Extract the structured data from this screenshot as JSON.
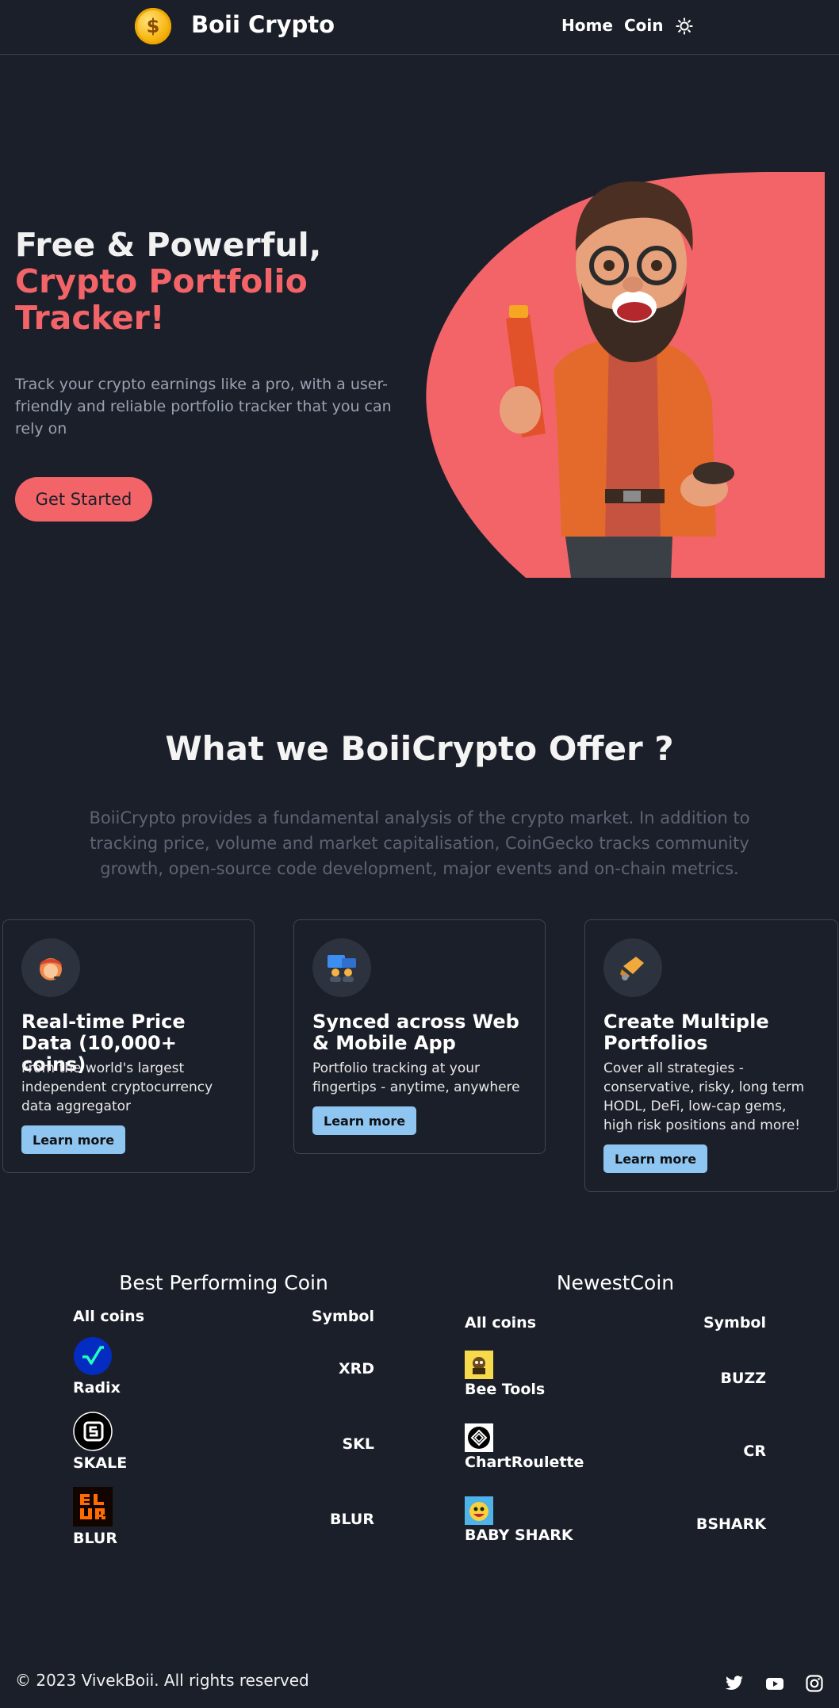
{
  "header": {
    "brand": "Boii Crypto",
    "logo_glyph": "$",
    "nav": [
      "Home",
      "Coin"
    ],
    "theme_icon": "sun-icon"
  },
  "hero": {
    "title_line1": "Free & Powerful,",
    "title_accent": "Crypto Portfolio Tracker!",
    "text": "Track your crypto earnings like a pro, with a user-friendly and reliable portfolio tracker that you can rely on",
    "cta": "Get Started",
    "accent_color": "#f36469"
  },
  "offer": {
    "title": "What we BoiiCrypto Offer ?",
    "text": "BoiiCrypto provides a fundamental analysis of the crypto market. In addition to tracking price, volume and market capitalisation, CoinGecko tracks community growth, open-source code development, major events and on-chain metrics.",
    "cards": [
      {
        "icon": "support-agent-icon",
        "title": "Real-time Price Data (10,000+ coins)",
        "text": "From the world's largest independent cryptocurrency data aggregator",
        "button": "Learn more"
      },
      {
        "icon": "devices-team-icon",
        "title": "Synced across Web & Mobile App",
        "text": "Portfolio tracking at your fingertips - anytime, anywhere",
        "button": "Learn more"
      },
      {
        "icon": "handshake-icon",
        "title": "Create Multiple Portfolios",
        "text": "Cover all strategies - conservative, risky, long term HODL, DeFi, low-cap gems, high risk positions and more!",
        "button": "Learn more"
      }
    ]
  },
  "best": {
    "heading": "Best Performing Coin",
    "col_coins": "All coins",
    "col_symbol": "Symbol",
    "rows": [
      {
        "name": "Radix",
        "symbol": "XRD",
        "icon": "radix-logo-icon"
      },
      {
        "name": "SKALE",
        "symbol": "SKL",
        "icon": "skale-logo-icon"
      },
      {
        "name": "BLUR",
        "symbol": "BLUR",
        "icon": "blur-logo-icon"
      }
    ]
  },
  "newest": {
    "heading": "NewestCoin",
    "col_coins": "All coins",
    "col_symbol": "Symbol",
    "rows": [
      {
        "name": "Bee Tools",
        "symbol": "BUZZ",
        "icon": "bee-tools-logo-icon"
      },
      {
        "name": "ChartRoulette",
        "symbol": "CR",
        "icon": "chartroulette-logo-icon"
      },
      {
        "name": "BABY SHARK",
        "symbol": "BSHARK",
        "icon": "baby-shark-logo-icon"
      }
    ]
  },
  "footer": {
    "copyright": "© 2023 VivekBoii. All rights reserved",
    "social": [
      "twitter-icon",
      "youtube-icon",
      "instagram-icon"
    ]
  }
}
